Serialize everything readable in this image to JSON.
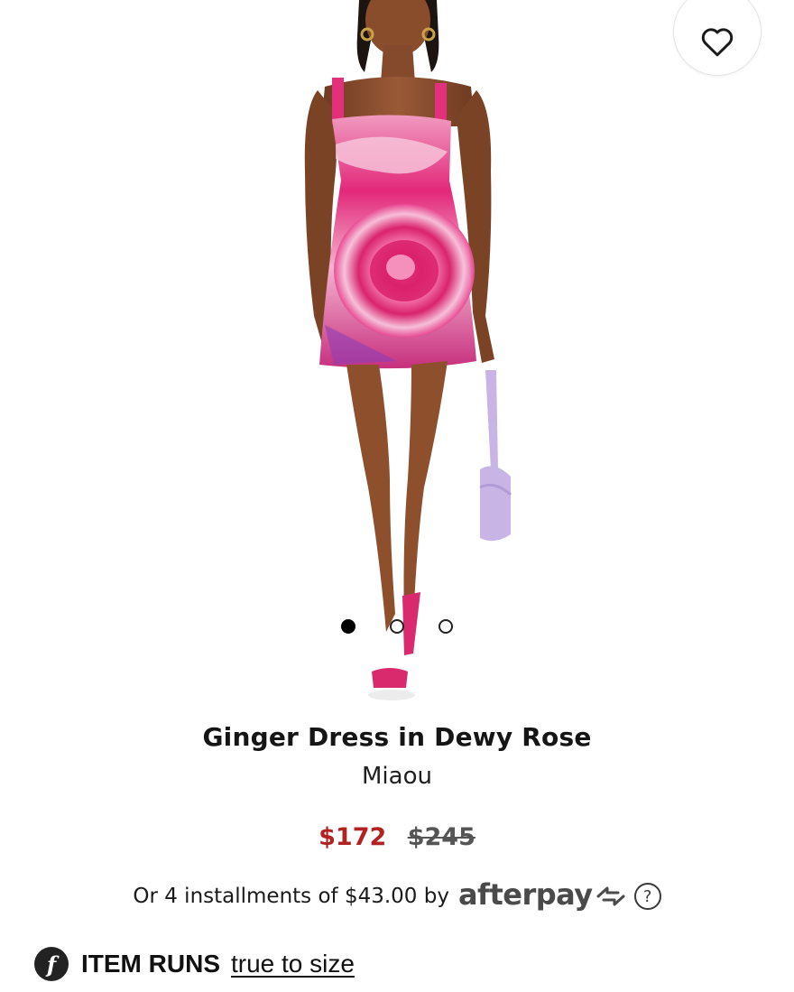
{
  "product": {
    "title": "Ginger Dress in Dewy Rose",
    "brand": "Miaou",
    "sale_price": "$172",
    "original_price": "$245",
    "image_count": 3,
    "active_image_index": 0
  },
  "afterpay": {
    "text": "Or 4 installments of $43.00 by",
    "logo_text": "afterpay",
    "help_symbol": "?"
  },
  "fit": {
    "icon_letter": "f",
    "label": "ITEM RUNS",
    "link_text": "true to size"
  },
  "icons": {
    "wishlist": "heart-icon",
    "help": "question-circle-icon",
    "fit": "fit-badge-icon",
    "afterpay": "afterpay-arrows-icon"
  },
  "colors": {
    "sale_price": "#b22222",
    "original_price": "#555555",
    "dress_pink": "#e8207a",
    "bag_lilac": "#c9b4e6",
    "text": "#1a1a1a"
  }
}
